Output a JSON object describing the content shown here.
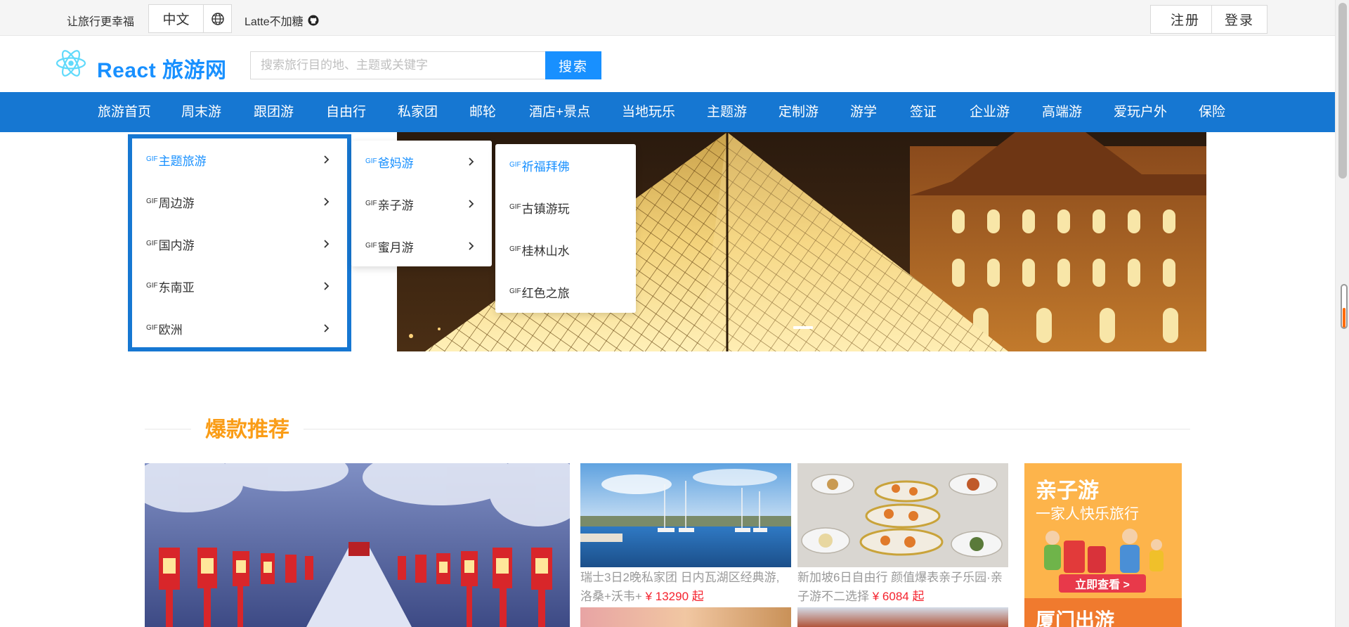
{
  "topbar": {
    "slogan": "让旅行更幸福",
    "language": "中文",
    "user_link": "Latte不加糖",
    "register_label": "注册",
    "login_label": "登录"
  },
  "header": {
    "brand": "React 旅游网",
    "search_placeholder": "搜索旅行目的地、主题或关键字",
    "search_button": "搜索"
  },
  "nav": {
    "items": [
      "旅游首页",
      "周末游",
      "跟团游",
      "自由行",
      "私家团",
      "邮轮",
      "酒店+景点",
      "当地玩乐",
      "主题游",
      "定制游",
      "游学",
      "签证",
      "企业游",
      "高端游",
      "爱玩户外",
      "保险"
    ]
  },
  "menu": {
    "gif_tag": "GIF",
    "level1": [
      "主题旅游",
      "周边游",
      "国内游",
      "东南亚",
      "欧洲"
    ],
    "level2": [
      "爸妈游",
      "亲子游",
      "蜜月游"
    ],
    "level3": [
      "祈福拜佛",
      "古镇游玩",
      "桂林山水",
      "红色之旅"
    ]
  },
  "section": {
    "title": "爆款推荐"
  },
  "products": [
    {
      "title": "瑞士3日2晚私家团 日内瓦湖区经典游,洛桑+沃韦+",
      "price": "¥ 13290 起"
    },
    {
      "title": "新加坡6日自由行 颜值爆表亲子乐园·亲子游不二选择",
      "price": "¥ 6084 起"
    }
  ],
  "promo": {
    "title": "亲子游",
    "subtitle": "一家人快乐旅行",
    "cta": "立即查看 >",
    "next_title": "厦门出游"
  },
  "colors": {
    "primary": "#1890ff",
    "nav_bg": "#1677d2",
    "section_title": "#fa9d17",
    "price": "#f5222d"
  }
}
